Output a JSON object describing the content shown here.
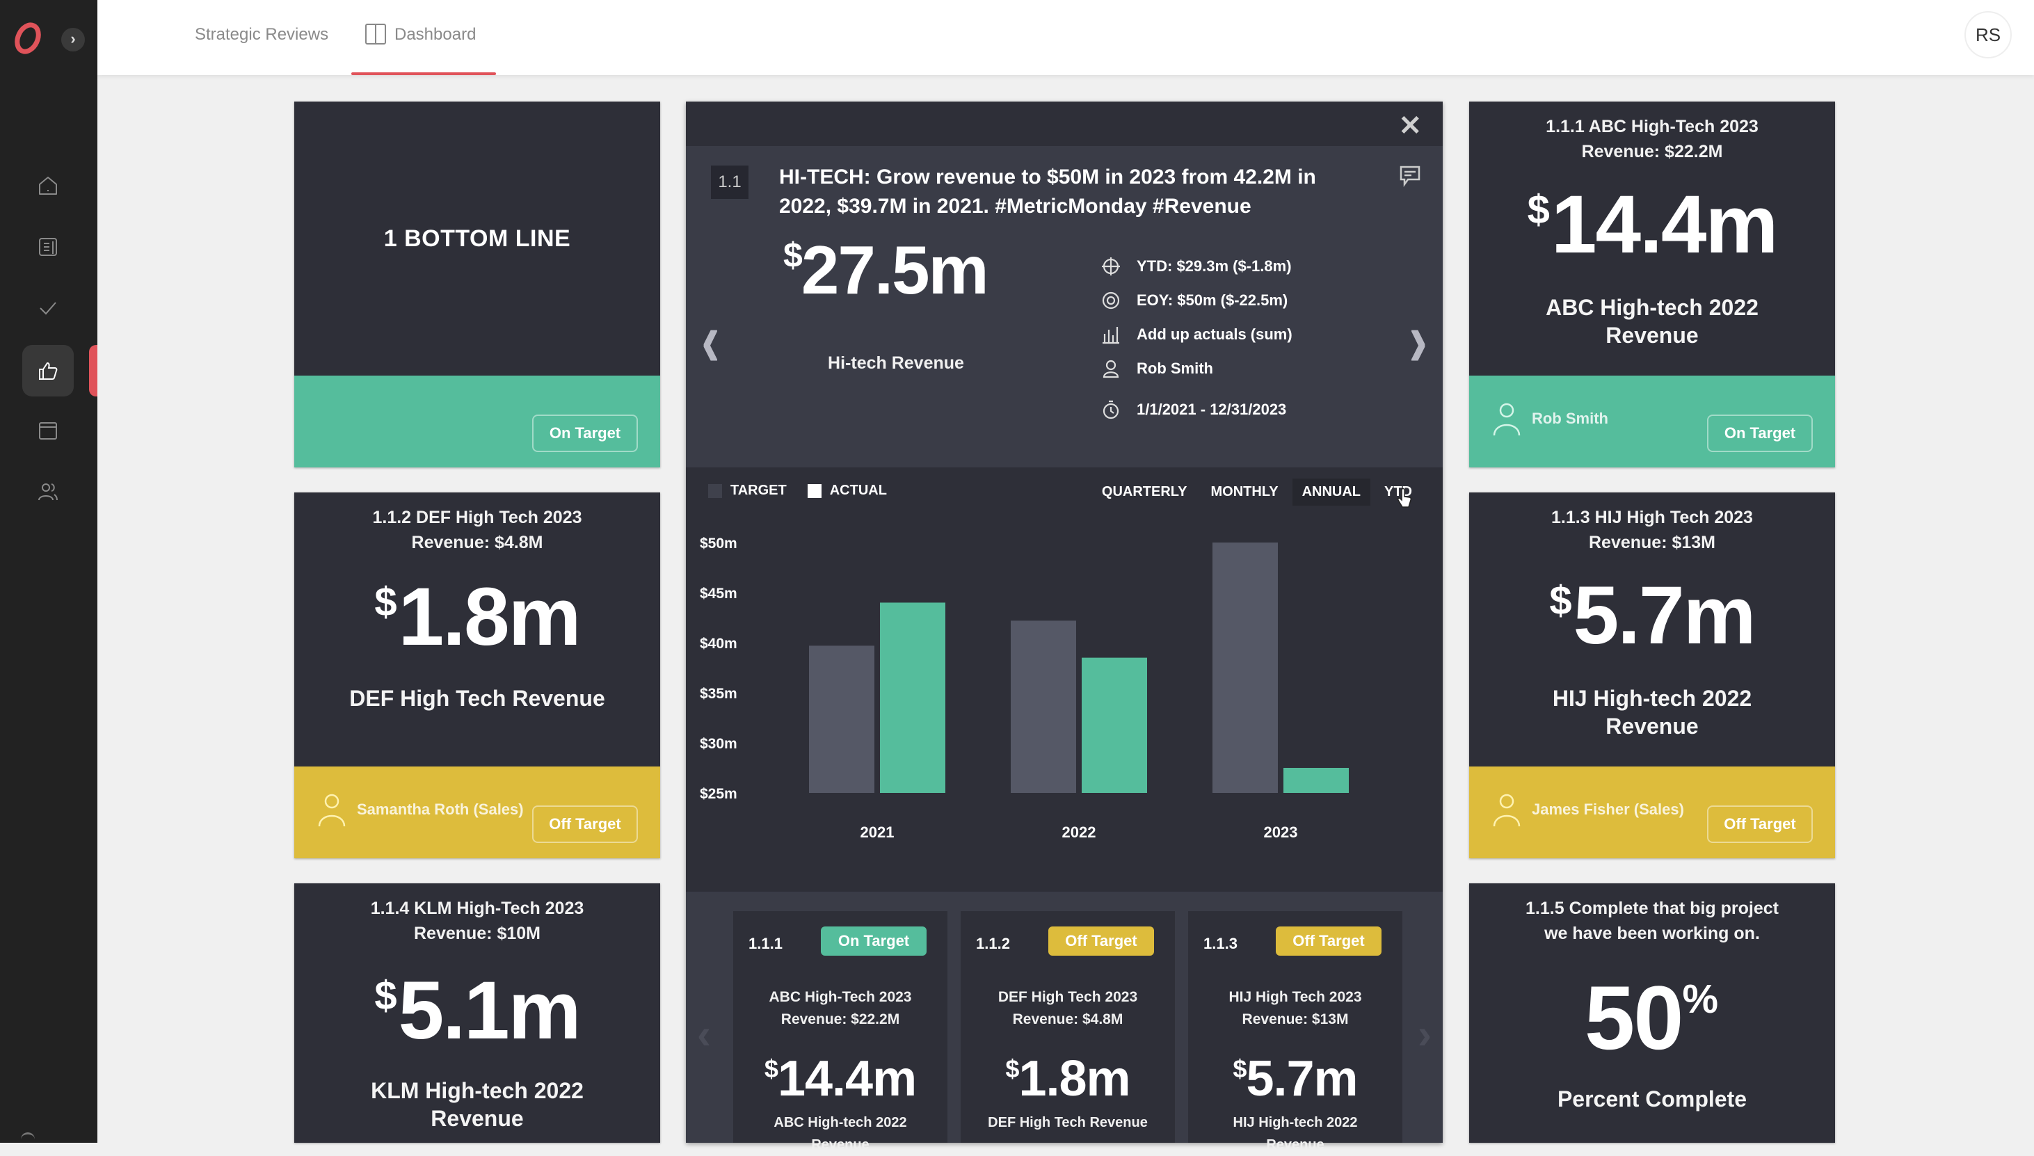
{
  "sidebar": {
    "items": [
      {
        "name": "home",
        "icon": "home-icon"
      },
      {
        "name": "reports",
        "icon": "document-icon"
      },
      {
        "name": "tasks",
        "icon": "check-icon"
      },
      {
        "name": "feedback",
        "icon": "thumbs-up-icon",
        "active": true
      },
      {
        "name": "calendar",
        "icon": "window-icon"
      },
      {
        "name": "people",
        "icon": "users-icon"
      }
    ],
    "expand_label": "›"
  },
  "topbar": {
    "breadcrumb": "Strategic Reviews",
    "active_tab": "Dashboard",
    "avatar_initials": "RS"
  },
  "colors": {
    "on_target": "#55bd9c",
    "off_target": "#ddbc3c",
    "accent": "#e0535a",
    "target_bar": "#555866",
    "actual_bar": "#55bd9c"
  },
  "cards": {
    "bottom_line": {
      "title": "1 BOTTOM LINE",
      "status": "On Target"
    },
    "def": {
      "title_line1": "1.1.2 DEF High Tech 2023",
      "title_line2": "Revenue: $4.8M",
      "currency": "$",
      "value": "1.8m",
      "label": "DEF High Tech Revenue",
      "owner": "Samantha Roth (Sales)",
      "status": "Off Target"
    },
    "klm": {
      "title_line1": "1.1.4 KLM High-Tech 2023",
      "title_line2": "Revenue: $10M",
      "currency": "$",
      "value": "5.1m",
      "label_line1": "KLM High-tech 2022",
      "label_line2": "Revenue"
    },
    "abc": {
      "title_line1": "1.1.1 ABC High-Tech 2023",
      "title_line2": "Revenue: $22.2M",
      "currency": "$",
      "value": "14.4m",
      "label_line1": "ABC High-tech 2022",
      "label_line2": "Revenue",
      "owner": "Rob Smith",
      "status": "On Target"
    },
    "hij": {
      "title_line1": "1.1.3 HIJ High Tech 2023",
      "title_line2": "Revenue: $13M",
      "currency": "$",
      "value": "5.7m",
      "label_line1": "HIJ High-tech 2022",
      "label_line2": "Revenue",
      "owner": "James Fisher (Sales)",
      "status": "Off Target"
    },
    "project": {
      "title_line1": "1.1.5 Complete that big project",
      "title_line2": "we have been working on.",
      "value": "50",
      "unit": "%",
      "label": "Percent Complete"
    }
  },
  "detail": {
    "close_label": "✕",
    "id": "1.1",
    "objective": "HI-TECH: Grow revenue to $50M in 2023 from 42.2M in 2022, $39.7M in 2021. #MetricMonday #Revenue",
    "currency": "$",
    "value": "27.5m",
    "value_label": "Hi-tech Revenue",
    "meta": [
      {
        "icon": "crosshair-icon",
        "text": "YTD: $29.3m ($-1.8m)"
      },
      {
        "icon": "target-icon",
        "text": "EOY: $50m ($-22.5m)"
      },
      {
        "icon": "bar-chart-icon",
        "text": "Add up actuals (sum)"
      },
      {
        "icon": "user-icon",
        "text": "Rob Smith"
      },
      {
        "icon": "alarm-clock-icon",
        "text": "1/1/2021 - 12/31/2023"
      }
    ],
    "prev_label": "‹",
    "next_label": "›"
  },
  "chart_controls": {
    "legend": [
      {
        "label": "TARGET"
      },
      {
        "label": "ACTUAL"
      }
    ],
    "periods": [
      {
        "label": "QUARTERLY",
        "active": false
      },
      {
        "label": "MONTHLY",
        "active": false
      },
      {
        "label": "ANNUAL",
        "active": true
      },
      {
        "label": "YTD",
        "active": false
      }
    ]
  },
  "chart_data": {
    "type": "bar",
    "title": "",
    "xlabel": "",
    "ylabel": "",
    "categories": [
      "2021",
      "2022",
      "2023"
    ],
    "series": [
      {
        "name": "TARGET",
        "values": [
          39.7,
          42.2,
          50.0
        ]
      },
      {
        "name": "ACTUAL",
        "values": [
          44.0,
          38.5,
          27.5
        ]
      }
    ],
    "ylim": [
      25,
      50
    ],
    "yticks": [
      25,
      30,
      35,
      40,
      45,
      50
    ],
    "ytick_labels": [
      "$25m",
      "$30m",
      "$35m",
      "$40m",
      "$45m",
      "$50m"
    ],
    "grid": false,
    "legend_position": "top-left"
  },
  "carousel": {
    "items": [
      {
        "id": "1.1.1",
        "status": "On Target",
        "status_type": "on",
        "title_line1": "ABC High-Tech 2023",
        "title_line2": "Revenue: $22.2M",
        "currency": "$",
        "value": "14.4m",
        "label_line1": "ABC High-tech 2022",
        "label_line2": "Revenue"
      },
      {
        "id": "1.1.2",
        "status": "Off Target",
        "status_type": "off",
        "title_line1": "DEF High Tech 2023",
        "title_line2": "Revenue: $4.8M",
        "currency": "$",
        "value": "1.8m",
        "label_line1": "DEF High Tech Revenue",
        "label_line2": ""
      },
      {
        "id": "1.1.3",
        "status": "Off Target",
        "status_type": "off",
        "title_line1": "HIJ High Tech 2023",
        "title_line2": "Revenue: $13M",
        "currency": "$",
        "value": "5.7m",
        "label_line1": "HIJ High-tech 2022",
        "label_line2": "Revenue"
      }
    ],
    "prev_label": "‹",
    "next_label": "›"
  }
}
